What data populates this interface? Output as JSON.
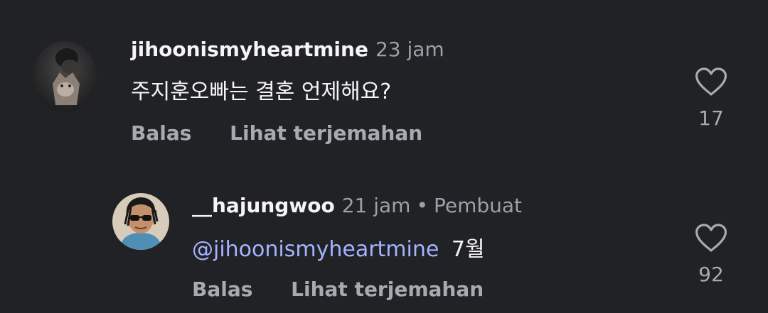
{
  "comments": [
    {
      "username": "jihoonismyheartmine",
      "time": "23 jam",
      "text": "주지훈오빠는 결혼 언제해요?",
      "reply_label": "Balas",
      "translate_label": "Lihat terjemahan",
      "like_count": "17",
      "avatar_icon": "user-photo-icon"
    }
  ],
  "replies": [
    {
      "username": "__hajungwoo",
      "time": "21 jam",
      "separator": "•",
      "badge": "Pembuat",
      "mention": "@jihoonismyheartmine",
      "text": "7월",
      "reply_label": "Balas",
      "translate_label": "Lihat terjemahan",
      "like_count": "92",
      "avatar_icon": "user-photo-icon"
    }
  ],
  "colors": {
    "background": "#212226",
    "primary_text": "#f5f5f5",
    "secondary_text": "#9ea0a6",
    "mention": "#a5b3ff"
  },
  "icons": {
    "like": "heart-outline-icon"
  }
}
